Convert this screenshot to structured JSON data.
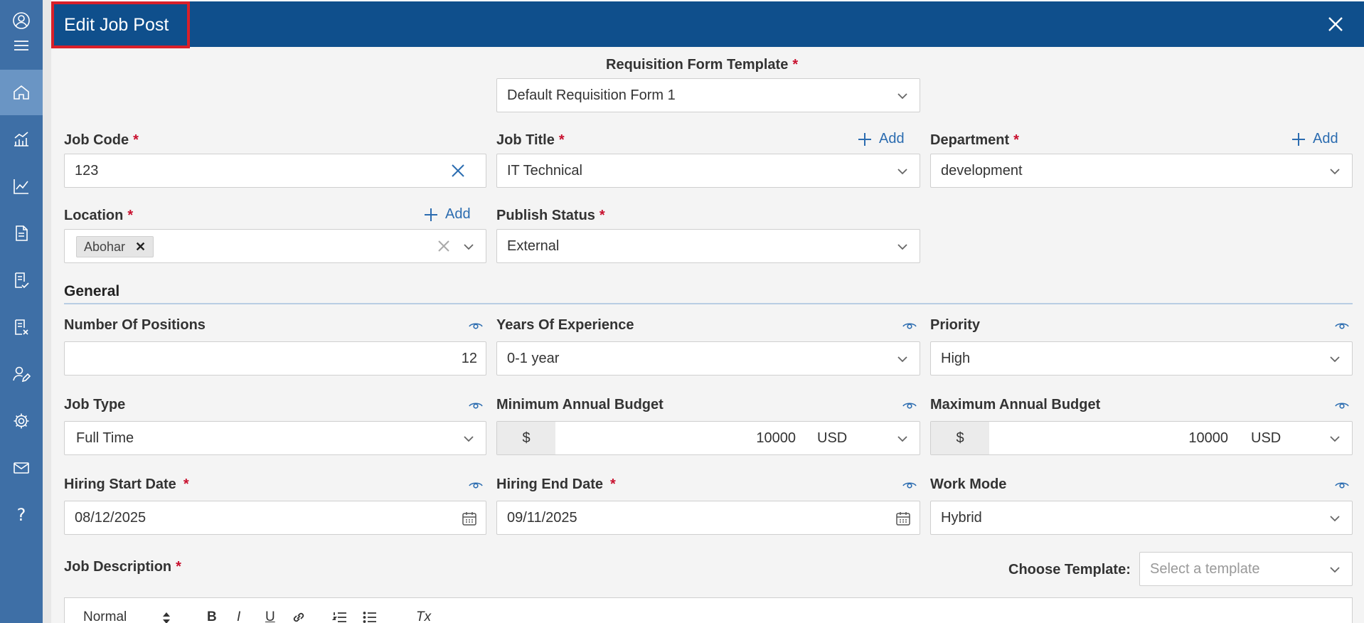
{
  "sidebar": {
    "items": [
      {
        "icon": "user-circle-icon"
      },
      {
        "icon": "menu-icon"
      },
      {
        "icon": "home-icon",
        "active": true
      },
      {
        "icon": "analytics-icon"
      },
      {
        "icon": "line-chart-icon"
      },
      {
        "icon": "document-icon"
      },
      {
        "icon": "document-check-icon"
      },
      {
        "icon": "document-remove-icon"
      },
      {
        "icon": "user-edit-icon"
      },
      {
        "icon": "settings-icon"
      },
      {
        "icon": "mail-icon"
      },
      {
        "icon": "help-icon",
        "glyph": "?"
      }
    ]
  },
  "panel": {
    "title": "Edit Job Post"
  },
  "form": {
    "requisition_template": {
      "label": "Requisition Form Template",
      "value": "Default Requisition Form 1"
    },
    "job_code": {
      "label": "Job Code",
      "value": "123"
    },
    "job_title": {
      "label": "Job Title",
      "value": "IT Technical",
      "add": "Add"
    },
    "department": {
      "label": "Department",
      "value": "development",
      "add": "Add"
    },
    "location": {
      "label": "Location",
      "tag": "Abohar",
      "add": "Add"
    },
    "publish_status": {
      "label": "Publish Status",
      "value": "External"
    }
  },
  "general": {
    "title": "General",
    "number_of_positions": {
      "label": "Number Of Positions",
      "value": "12"
    },
    "years_of_experience": {
      "label": "Years Of Experience",
      "value": "0-1 year"
    },
    "priority": {
      "label": "Priority",
      "value": "High"
    },
    "job_type": {
      "label": "Job Type",
      "value": "Full Time"
    },
    "min_budget": {
      "label": "Minimum Annual Budget",
      "prefix": "$",
      "value": "10000",
      "currency": "USD"
    },
    "max_budget": {
      "label": "Maximum Annual Budget",
      "prefix": "$",
      "value": "10000",
      "currency": "USD"
    },
    "hiring_start": {
      "label": "Hiring Start Date",
      "value": "08/12/2025"
    },
    "hiring_end": {
      "label": "Hiring End Date",
      "value": "09/11/2025"
    },
    "work_mode": {
      "label": "Work Mode",
      "value": "Hybrid"
    }
  },
  "job_description": {
    "label": "Job Description",
    "choose_template_label": "Choose Template:",
    "template_placeholder": "Select a template",
    "toolbar": {
      "style": "Normal",
      "bold": "B",
      "italic": "I",
      "underline": "U",
      "clear_format": "Tx"
    }
  },
  "colors": {
    "header": "#0f4f8c",
    "sidebar": "#3e6fa6",
    "accent": "#2b6cb0",
    "required": "#c8102e",
    "highlight": "#d9202a"
  }
}
